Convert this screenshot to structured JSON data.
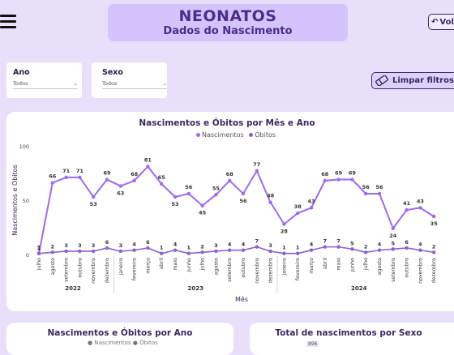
{
  "header": {
    "title": "NEONATOS",
    "subtitle": "Dados do Nascimento",
    "back_label": "Voltar"
  },
  "filters": {
    "ano": {
      "label": "Ano",
      "value": "Todos"
    },
    "sexo": {
      "label": "Sexo",
      "value": "Todos"
    },
    "clear_label": "Limpar filtros"
  },
  "colors": {
    "accent": "#9a6cf0",
    "obitos": "#8a63c9",
    "background": "#e8e0fb",
    "header": "#d4c4fb"
  },
  "chart_data": {
    "type": "line",
    "title": "Nascimentos e Óbitos por Mês e Ano",
    "xlabel": "Mês",
    "ylabel": "Nascimentos e Óbitos",
    "ylim": [
      0,
      100
    ],
    "yticks": [
      0,
      50,
      100
    ],
    "legend": "top-center",
    "categories": [
      "julho",
      "agosto",
      "setembro",
      "outubro",
      "novembro",
      "dezembro",
      "janeiro",
      "fevereiro",
      "março",
      "abril",
      "maio",
      "junho",
      "julho",
      "agosto",
      "setembro",
      "outubro",
      "novembro",
      "dezembro",
      "janeiro",
      "fevereiro",
      "março",
      "abril",
      "maio",
      "junho",
      "julho",
      "agosto",
      "setembro",
      "outubro",
      "novembro",
      "dezembro"
    ],
    "years": [
      {
        "label": "2022",
        "start": 0,
        "end": 5
      },
      {
        "label": "2023",
        "start": 6,
        "end": 17
      },
      {
        "label": "2024",
        "start": 18,
        "end": 29
      }
    ],
    "series": [
      {
        "name": "Nascimentos",
        "values": [
          1,
          66,
          71,
          71,
          53,
          69,
          63,
          68,
          81,
          65,
          53,
          56,
          45,
          55,
          68,
          56,
          77,
          48,
          28,
          38,
          43,
          68,
          69,
          69,
          56,
          56,
          24,
          41,
          43,
          35
        ]
      },
      {
        "name": "Óbitos",
        "values": [
          1,
          2,
          3,
          3,
          3,
          6,
          3,
          4,
          6,
          1,
          4,
          1,
          2,
          3,
          4,
          4,
          7,
          3,
          1,
          1,
          4,
          7,
          7,
          5,
          2,
          4,
          5,
          6,
          4,
          2
        ]
      }
    ]
  },
  "bottom": {
    "left_title": "Nascimentos e Óbitos por Ano",
    "left_legend": "● Nascimentos ● Óbitos",
    "right_title": "Total de nascimentos por Sexo",
    "right_badge": "896"
  }
}
